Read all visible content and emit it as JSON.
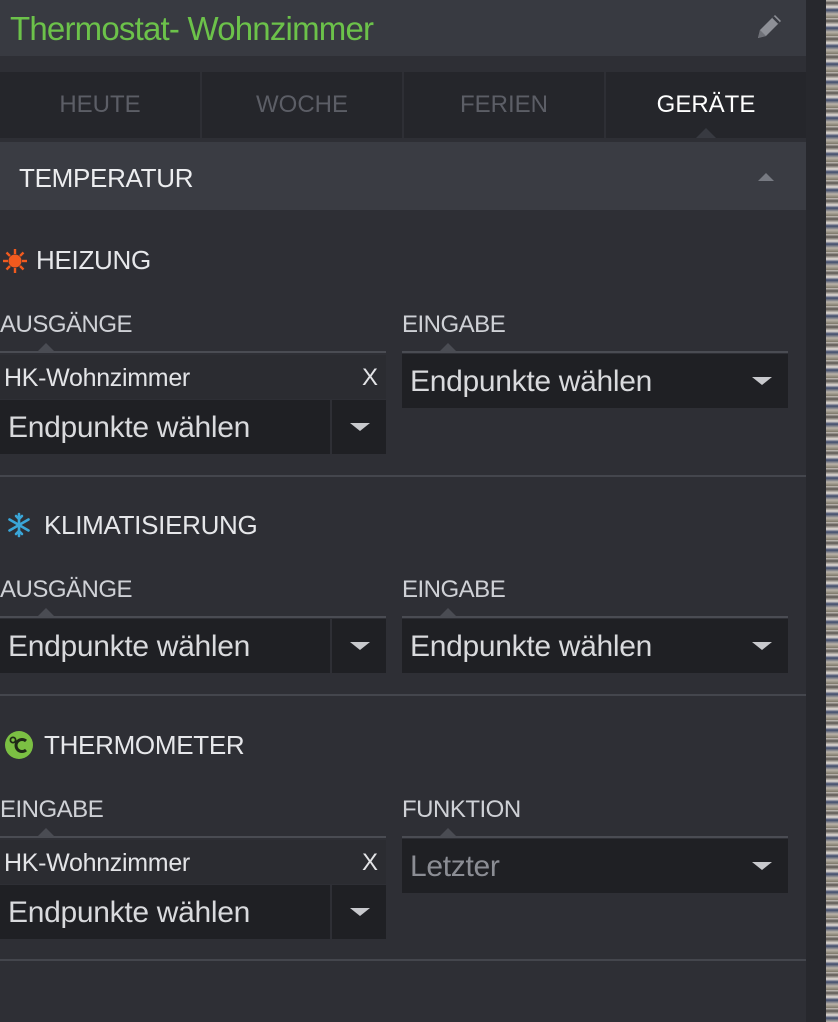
{
  "header": {
    "title": "Thermostat- Wohnzimmer",
    "edit_icon": "pencil-icon"
  },
  "tabs": [
    {
      "label": "HEUTE",
      "active": false
    },
    {
      "label": "WOCHE",
      "active": false
    },
    {
      "label": "FERIEN",
      "active": false
    },
    {
      "label": "GERÄTE",
      "active": true
    }
  ],
  "section": {
    "title": "TEMPERATUR",
    "collapse_icon": "triangle-up-icon"
  },
  "heizung": {
    "title": "HEIZUNG",
    "icon": "sun-icon",
    "icon_color": "#f05a1e",
    "outputs_label": "AUSGÄNGE",
    "outputs_chip": "HK-Wohnzimmer",
    "chip_remove": "X",
    "outputs_select": "Endpunkte wählen",
    "input_label": "EINGABE",
    "input_select": "Endpunkte wählen"
  },
  "klima": {
    "title": "KLIMATISIERUNG",
    "icon": "snowflake-icon",
    "icon_color": "#3aa6d8",
    "outputs_label": "AUSGÄNGE",
    "outputs_select": "Endpunkte wählen",
    "input_label": "EINGABE",
    "input_select": "Endpunkte wählen"
  },
  "thermo": {
    "title": "THERMOMETER",
    "icon": "celsius-icon",
    "icon_color": "#7bc043",
    "input_label": "EINGABE",
    "input_chip": "HK-Wohnzimmer",
    "chip_remove": "X",
    "input_select": "Endpunkte wählen",
    "function_label": "FUNKTION",
    "function_select": "Letzter"
  },
  "colors": {
    "accent": "#6cc24a",
    "background": "#2e2f35"
  }
}
